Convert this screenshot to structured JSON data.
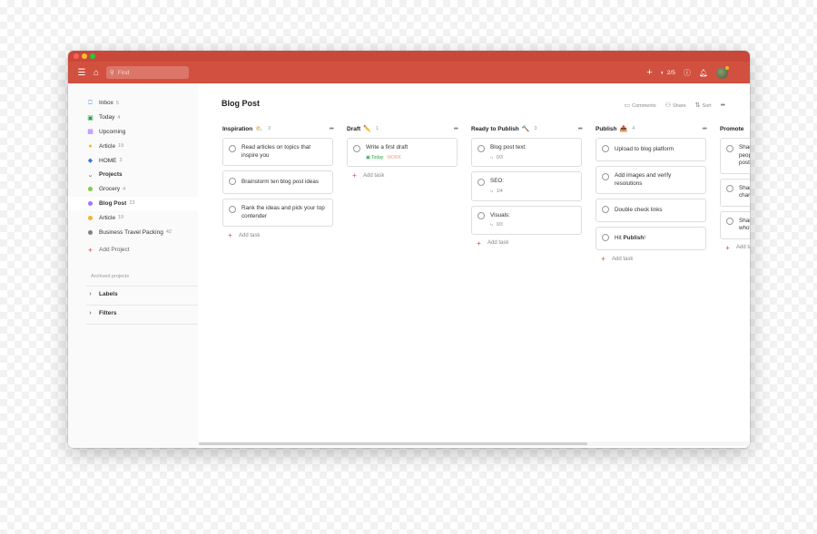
{
  "topbar": {
    "search_placeholder": "Find",
    "karma": "2/5"
  },
  "sidebar": {
    "items": [
      {
        "label": "Inbox",
        "count": "5",
        "icon": "inbox-icon",
        "color": "#4073d6"
      },
      {
        "label": "Today",
        "count": "4",
        "icon": "calendar-today-icon",
        "color": "#25a244"
      },
      {
        "label": "Upcoming",
        "count": "",
        "icon": "calendar-upcoming-icon",
        "color": "#a970ff"
      },
      {
        "label": "Article",
        "count": "19",
        "icon": "person-icon",
        "color": "#f0b429"
      },
      {
        "label": "HOME",
        "count": "3",
        "icon": "tag-icon",
        "color": "#4073d6"
      }
    ],
    "projects_label": "Projects",
    "projects": [
      {
        "label": "Grocery",
        "count": "4",
        "color": "#7ecc49"
      },
      {
        "label": "Blog Post",
        "count": "23",
        "color": "#a970ff"
      },
      {
        "label": "Article",
        "count": "19",
        "color": "#f0b429"
      },
      {
        "label": "Business Travel Packing",
        "count": "42",
        "color": "#808080"
      }
    ],
    "add_project": "Add Project",
    "archived": "Archived projects",
    "labels": "Labels",
    "filters": "Filters"
  },
  "main": {
    "title": "Blog Post",
    "actions": {
      "comments": "Comments",
      "share": "Share",
      "sort": "Sort"
    },
    "add_task": "Add task",
    "columns": [
      {
        "name": "Inspiration",
        "emoji": "⛅",
        "count": "3",
        "cards": [
          {
            "text": "Read articles on topics that inspire you"
          },
          {
            "text": "Brainstorm ten blog post ideas"
          },
          {
            "text": "Rank the ideas and pick your top contender"
          }
        ]
      },
      {
        "name": "Draft",
        "emoji": "✏️",
        "count": "1",
        "cards": [
          {
            "text": "Write a first draft",
            "date": "Today",
            "label": "WORK"
          }
        ]
      },
      {
        "name": "Ready to Publish",
        "emoji": "🔨",
        "count": "3",
        "cards": [
          {
            "text": "Blog post text:",
            "sub": "0/3"
          },
          {
            "text": "SEO:",
            "sub": "1/4"
          },
          {
            "text": "Visuals:",
            "sub": "0/3"
          }
        ]
      },
      {
        "name": "Publish",
        "emoji": "📤",
        "count": "4",
        "cards": [
          {
            "text": "Upload to blog platform"
          },
          {
            "text": "Add images and verify resolutions"
          },
          {
            "text": "Double check links"
          },
          {
            "text": "Hit ",
            "bold": "Publish",
            "suffix": "!"
          }
        ]
      },
      {
        "name": "Promote",
        "emoji": "",
        "count": "",
        "cards": [
          {
            "text": "Shar peop post"
          },
          {
            "text": "Shar chan"
          },
          {
            "text": "Shar who'"
          }
        ]
      }
    ]
  }
}
